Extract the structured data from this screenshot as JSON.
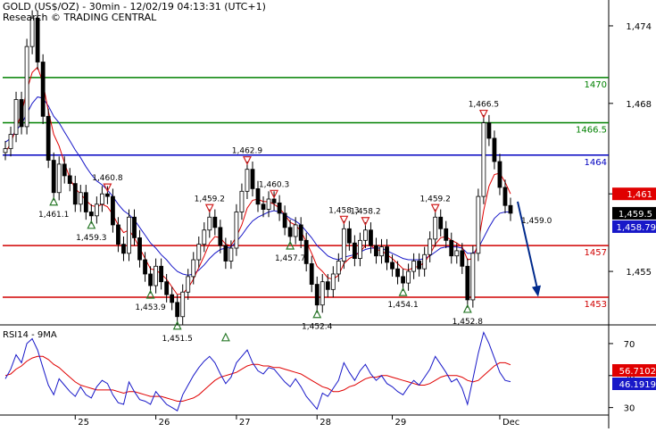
{
  "header": {
    "line1": "GOLD (US$/OZ) - 30min - 12/02/19 04:13:31 (UTC+1)",
    "line2": "Research © TRADING CENTRAL"
  },
  "colors": {
    "candle": "#000000",
    "ma_fast": "#e00000",
    "ma_slow": "#1818c8",
    "support": "#d00000",
    "resistance": "#008000",
    "pivot": "#0000c0",
    "arrow": "#002a8c",
    "marker_up": "#2a7a2a",
    "marker_down": "#d02020",
    "price_box": "#000000",
    "ma_box": "#1818c8"
  },
  "chart_data": [
    {
      "type": "line",
      "title": "GOLD (US$/OZ) - 30min",
      "x": [
        "25",
        "26",
        "27",
        "28",
        "29",
        "Dec"
      ],
      "ylim": [
        1451,
        1476
      ],
      "y_ticks": [
        "1,474",
        "1,468",
        "1,461",
        "1,455"
      ],
      "levels": [
        {
          "label": "1470",
          "value": 1470,
          "role": "resistance"
        },
        {
          "label": "1466.5",
          "value": 1466.5,
          "role": "resistance"
        },
        {
          "label": "1464",
          "value": 1464,
          "role": "pivot"
        },
        {
          "label": "1457",
          "value": 1457,
          "role": "support"
        },
        {
          "label": "1453",
          "value": 1453,
          "role": "support"
        }
      ],
      "series": [
        {
          "values": [
            1464.5,
            1465.6,
            1468.3,
            1466.2,
            1472.4,
            1474.6,
            1471.2,
            1467.0,
            1463.6,
            1461.1,
            1463.3,
            1462.4,
            1461.8,
            1460.2,
            1461.1,
            1459.6,
            1459.3,
            1460.2,
            1461.0,
            1460.8,
            1458.6,
            1457.1,
            1456.4,
            1459.2,
            1457.6,
            1455.9,
            1454.8,
            1453.9,
            1455.4,
            1454.2,
            1453.2,
            1452.6,
            1451.5,
            1453.4,
            1454.6,
            1455.9,
            1457.1,
            1458.2,
            1459.2,
            1458.4,
            1457.0,
            1455.8,
            1456.8,
            1459.6,
            1461.2,
            1462.9,
            1461.4,
            1460.2,
            1459.8,
            1460.6,
            1460.3,
            1459.5,
            1458.4,
            1457.7,
            1458.6,
            1457.4,
            1455.6,
            1454.0,
            1452.4,
            1454.2,
            1453.6,
            1454.8,
            1455.8,
            1458.3,
            1457.2,
            1456.0,
            1457.4,
            1458.2,
            1457.0,
            1456.2,
            1456.9,
            1455.7,
            1455.2,
            1454.6,
            1454.1,
            1455.0,
            1455.8,
            1455.2,
            1456.3,
            1457.5,
            1459.2,
            1458.3,
            1457.4,
            1456.2,
            1456.6,
            1455.4,
            1452.8,
            1456.4,
            1460.8,
            1466.5,
            1465.3,
            1463.5,
            1461.5,
            1460.1,
            1459.5
          ]
        },
        {
          "name": "",
          "values": [
            1464.2,
            1464.9,
            1466.1,
            1467.2,
            1469.0,
            1470.4,
            1470.8,
            1469.6,
            1467.4,
            1465.6,
            1464.7,
            1463.4,
            1462.2,
            1461.4,
            1461.0,
            1460.5,
            1460.1,
            1460.0,
            1460.2,
            1460.0,
            1459.4,
            1458.6,
            1458.0,
            1458.2,
            1457.6,
            1456.8,
            1456.0,
            1455.2,
            1455.1,
            1454.8,
            1454.4,
            1453.8,
            1453.2,
            1453.3,
            1453.7,
            1454.4,
            1455.3,
            1456.2,
            1457.2,
            1457.7,
            1457.6,
            1457.1,
            1457.0,
            1457.7,
            1458.6,
            1459.9,
            1460.5,
            1460.6,
            1460.4,
            1460.4,
            1460.2,
            1459.9,
            1459.4,
            1458.8,
            1458.6,
            1458.1,
            1457.3,
            1456.4,
            1455.4,
            1455.0,
            1454.5,
            1454.4,
            1454.7,
            1455.6,
            1456.0,
            1456.2,
            1456.5,
            1457.0,
            1457.0,
            1456.7,
            1456.6,
            1456.3,
            1456.0,
            1455.6,
            1455.2,
            1455.1,
            1455.3,
            1455.4,
            1455.7,
            1456.3,
            1457.1,
            1457.6,
            1457.7,
            1457.4,
            1457.2,
            1456.9,
            1455.9,
            1456.0,
            1457.2,
            1459.7,
            1461.6,
            1462.5,
            1462.6,
            1461.9,
            1461.0
          ]
        },
        {
          "name": "",
          "values": [
            1465.0,
            1465.3,
            1465.9,
            1466.4,
            1467.2,
            1468.0,
            1468.5,
            1468.4,
            1467.8,
            1467.0,
            1466.5,
            1465.8,
            1465.1,
            1464.4,
            1463.8,
            1463.1,
            1462.5,
            1462.0,
            1461.7,
            1461.3,
            1460.8,
            1460.2,
            1459.7,
            1459.4,
            1459.0,
            1458.4,
            1457.8,
            1457.2,
            1456.8,
            1456.3,
            1455.9,
            1455.4,
            1455.0,
            1454.8,
            1454.7,
            1454.8,
            1455.1,
            1455.5,
            1456.0,
            1456.4,
            1456.7,
            1456.8,
            1456.9,
            1457.3,
            1457.8,
            1458.4,
            1458.9,
            1459.2,
            1459.4,
            1459.6,
            1459.7,
            1459.6,
            1459.4,
            1459.1,
            1458.9,
            1458.6,
            1458.1,
            1457.6,
            1457.0,
            1456.6,
            1456.2,
            1456.0,
            1455.9,
            1456.1,
            1456.2,
            1456.3,
            1456.5,
            1456.7,
            1456.8,
            1456.8,
            1456.8,
            1456.6,
            1456.4,
            1456.2,
            1456.0,
            1455.9,
            1455.9,
            1455.9,
            1456.0,
            1456.2,
            1456.5,
            1456.8,
            1456.9,
            1456.9,
            1456.9,
            1456.8,
            1456.4,
            1456.4,
            1456.8,
            1457.6,
            1458.4,
            1459.1,
            1459.5,
            1459.6,
            1459.6
          ]
        }
      ],
      "annotations": [
        {
          "label": "1,461.1",
          "x": 9,
          "y": 1461.1,
          "marker": "up"
        },
        {
          "label": "1,459.3",
          "x": 16,
          "y": 1459.3,
          "marker": "up"
        },
        {
          "label": "1,460.8",
          "x": 19,
          "y": 1460.8,
          "marker": "down"
        },
        {
          "label": "1,453.9",
          "x": 27,
          "y": 1453.9,
          "marker": "up"
        },
        {
          "label": "1,451.5",
          "x": 32,
          "y": 1451.5,
          "marker": "up"
        },
        {
          "label": "1,459.2",
          "x": 38,
          "y": 1459.2,
          "marker": "down"
        },
        {
          "label": "",
          "x": 41,
          "y": 1450.6,
          "marker": "up"
        },
        {
          "label": "1,462.9",
          "x": 45,
          "y": 1462.9,
          "marker": "down"
        },
        {
          "label": "1,460.3",
          "x": 50,
          "y": 1460.3,
          "marker": "down"
        },
        {
          "label": "1,457.7",
          "x": 53,
          "y": 1457.7,
          "marker": "up"
        },
        {
          "label": "1,452.4",
          "x": 58,
          "y": 1452.4,
          "marker": "up"
        },
        {
          "label": "1,458.3",
          "x": 63,
          "y": 1458.3,
          "marker": "down"
        },
        {
          "label": "1,458.2",
          "x": 67,
          "y": 1458.2,
          "marker": "down"
        },
        {
          "label": "1,454.1",
          "x": 74,
          "y": 1454.1,
          "marker": "up"
        },
        {
          "label": "1,459.2",
          "x": 80,
          "y": 1459.2,
          "marker": "down"
        },
        {
          "label": "1,452.8",
          "x": 86,
          "y": 1452.8,
          "marker": "up"
        },
        {
          "label": "1,466.5",
          "x": 89,
          "y": 1466.5,
          "marker": "down"
        },
        {
          "label": "1,459.0",
          "x": 94,
          "y": 1459.0,
          "marker": "none"
        }
      ],
      "forecast_arrow": {
        "from": 1460.4,
        "to": 1453.1
      },
      "last_price": "1,459.5",
      "ma_last": "1,458.79",
      "partial_label": "1,461"
    },
    {
      "type": "line",
      "title": "RSI14 - 9MA",
      "ylim": [
        27,
        80
      ],
      "y_ticks": [
        "70",
        "50",
        "30"
      ],
      "series": [
        {
          "name": "RSI14",
          "values": [
            48,
            54,
            63,
            58,
            70,
            73,
            66,
            55,
            44,
            38,
            48,
            44,
            40,
            37,
            43,
            38,
            36,
            43,
            47,
            45,
            38,
            33,
            32,
            46,
            40,
            35,
            34,
            32,
            40,
            36,
            32,
            30,
            28,
            38,
            44,
            50,
            55,
            59,
            62,
            58,
            51,
            45,
            49,
            58,
            62,
            66,
            58,
            53,
            51,
            55,
            54,
            50,
            46,
            43,
            48,
            43,
            37,
            33,
            29,
            39,
            37,
            42,
            47,
            58,
            52,
            47,
            53,
            57,
            51,
            47,
            50,
            45,
            43,
            40,
            38,
            43,
            47,
            44,
            49,
            54,
            62,
            57,
            52,
            46,
            48,
            42,
            32,
            48,
            64,
            77,
            70,
            61,
            52,
            47,
            46.19
          ]
        },
        {
          "name": "9MA",
          "values": [
            50,
            51,
            54,
            56,
            59,
            61,
            62,
            62,
            60,
            57,
            55,
            52,
            49,
            46,
            44,
            43,
            42,
            41,
            41,
            41,
            41,
            40,
            39,
            40,
            40,
            39,
            38,
            37,
            37,
            37,
            36,
            35,
            34,
            34,
            35,
            36,
            38,
            41,
            44,
            47,
            49,
            50,
            51,
            52,
            54,
            56,
            57,
            57,
            56,
            56,
            55,
            55,
            54,
            53,
            52,
            51,
            49,
            47,
            45,
            43,
            42,
            40,
            40,
            41,
            43,
            44,
            46,
            48,
            49,
            49,
            50,
            50,
            49,
            48,
            47,
            46,
            45,
            44,
            44,
            45,
            47,
            49,
            50,
            50,
            50,
            49,
            47,
            46,
            47,
            50,
            53,
            56,
            58,
            58,
            56.71
          ]
        }
      ],
      "value_labels": [
        "56.7102",
        "46.1919"
      ]
    }
  ]
}
